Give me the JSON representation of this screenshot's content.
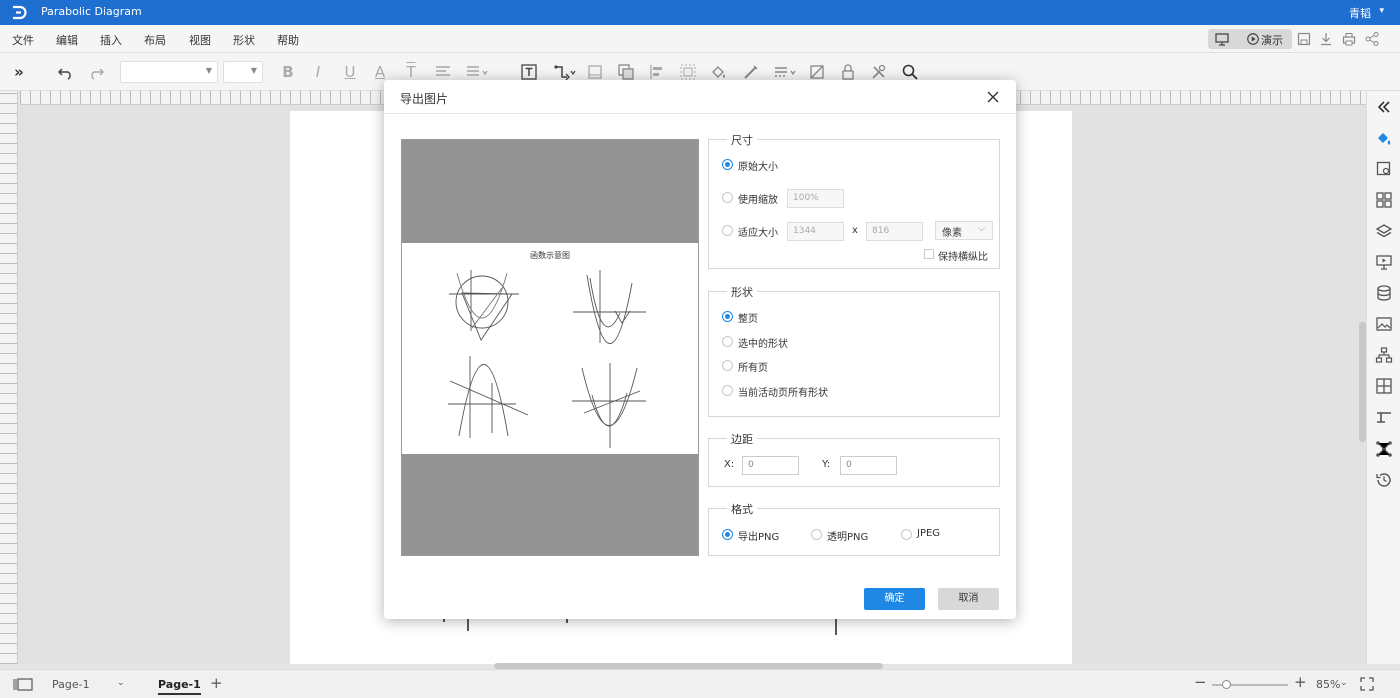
{
  "app": {
    "title": "Parabolic Diagram",
    "user": "青韬"
  },
  "menu": [
    "文件",
    "编辑",
    "插入",
    "布局",
    "视图",
    "形状",
    "帮助"
  ],
  "present": {
    "label": "演示"
  },
  "dialog": {
    "title": "导出图片",
    "preview_title": "函数示意图",
    "size": {
      "legend": "尺寸",
      "original": "原始大小",
      "scale": "使用缩放",
      "scale_value": "100%",
      "fit": "适应大小",
      "width": "1344",
      "x": "x",
      "height": "816",
      "unit": "像素",
      "keep_ratio": "保持横纵比"
    },
    "shape": {
      "legend": "形状",
      "options": [
        "整页",
        "选中的形状",
        "所有页",
        "当前活动页所有形状"
      ]
    },
    "margin": {
      "legend": "边距",
      "x_label": "X:",
      "x_value": "0",
      "y_label": "Y:",
      "y_value": "0"
    },
    "format": {
      "legend": "格式",
      "options": [
        "导出PNG",
        "透明PNG",
        "JPEG"
      ]
    },
    "ok": "确定",
    "cancel": "取消"
  },
  "status": {
    "page_selector": "Page-1",
    "active_tab": "Page-1",
    "zoom": "85%"
  },
  "colors": {
    "titlebar": "#1f6fd0",
    "accent": "#1f88e5"
  }
}
